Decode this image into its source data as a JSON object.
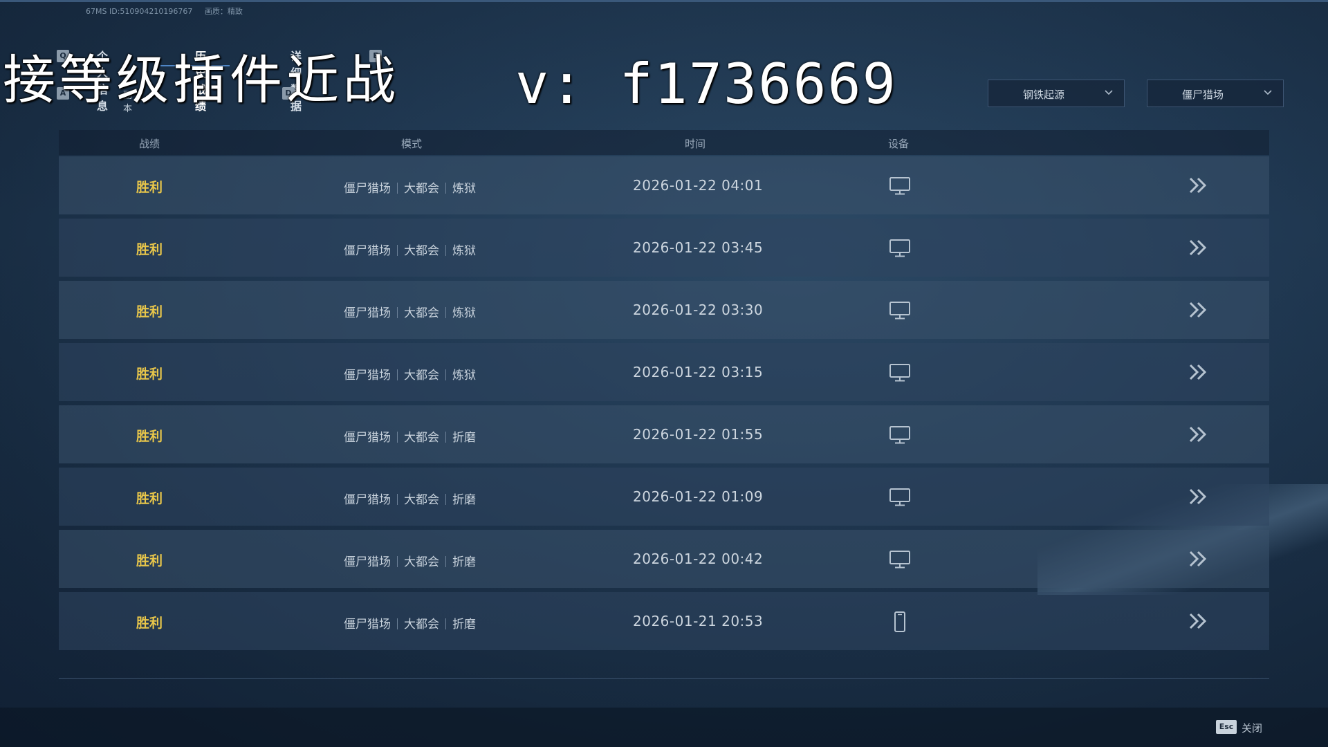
{
  "header": {
    "latency": "67MS",
    "id_text": "ID:510904210196767",
    "quality": "画质：精致"
  },
  "tabs": [
    {
      "key": "Q",
      "label": "个人信息"
    },
    {
      "key": "",
      "label": "历史战绩",
      "active": true
    },
    {
      "key": "",
      "label": "详细数据"
    },
    {
      "key": "E",
      "label": ""
    }
  ],
  "subtabs": {
    "left_key": "A",
    "left_label": "副本",
    "mid_label": "",
    "right_key": "D"
  },
  "overlay_text": {
    "left": "接等级插件近战",
    "right": "v: f1736669"
  },
  "filters": [
    {
      "label": "钢铁起源"
    },
    {
      "label": "僵尸猎场"
    }
  ],
  "table": {
    "columns": [
      "战绩",
      "模式",
      "时间",
      "设备"
    ],
    "rows": [
      {
        "result": "胜利",
        "mode": [
          "僵尸猎场",
          "大都会",
          "炼狱"
        ],
        "time": "2026-01-22 04:01",
        "device": "monitor-icon"
      },
      {
        "result": "胜利",
        "mode": [
          "僵尸猎场",
          "大都会",
          "炼狱"
        ],
        "time": "2026-01-22 03:45",
        "device": "monitor-icon"
      },
      {
        "result": "胜利",
        "mode": [
          "僵尸猎场",
          "大都会",
          "炼狱"
        ],
        "time": "2026-01-22 03:30",
        "device": "monitor-icon"
      },
      {
        "result": "胜利",
        "mode": [
          "僵尸猎场",
          "大都会",
          "炼狱"
        ],
        "time": "2026-01-22 03:15",
        "device": "monitor-icon"
      },
      {
        "result": "胜利",
        "mode": [
          "僵尸猎场",
          "大都会",
          "折磨"
        ],
        "time": "2026-01-22 01:55",
        "device": "monitor-icon"
      },
      {
        "result": "胜利",
        "mode": [
          "僵尸猎场",
          "大都会",
          "折磨"
        ],
        "time": "2026-01-22 01:09",
        "device": "monitor-icon"
      },
      {
        "result": "胜利",
        "mode": [
          "僵尸猎场",
          "大都会",
          "折磨"
        ],
        "time": "2026-01-22 00:42",
        "device": "monitor-icon"
      },
      {
        "result": "胜利",
        "mode": [
          "僵尸猎场",
          "大都会",
          "折磨"
        ],
        "time": "2026-01-21 20:53",
        "device": "phone-icon"
      }
    ]
  },
  "footer": {
    "esc_key": "Esc",
    "close_label": "关闭"
  },
  "colors": {
    "victory": "#e8c64a",
    "accent": "#4f86c6"
  }
}
